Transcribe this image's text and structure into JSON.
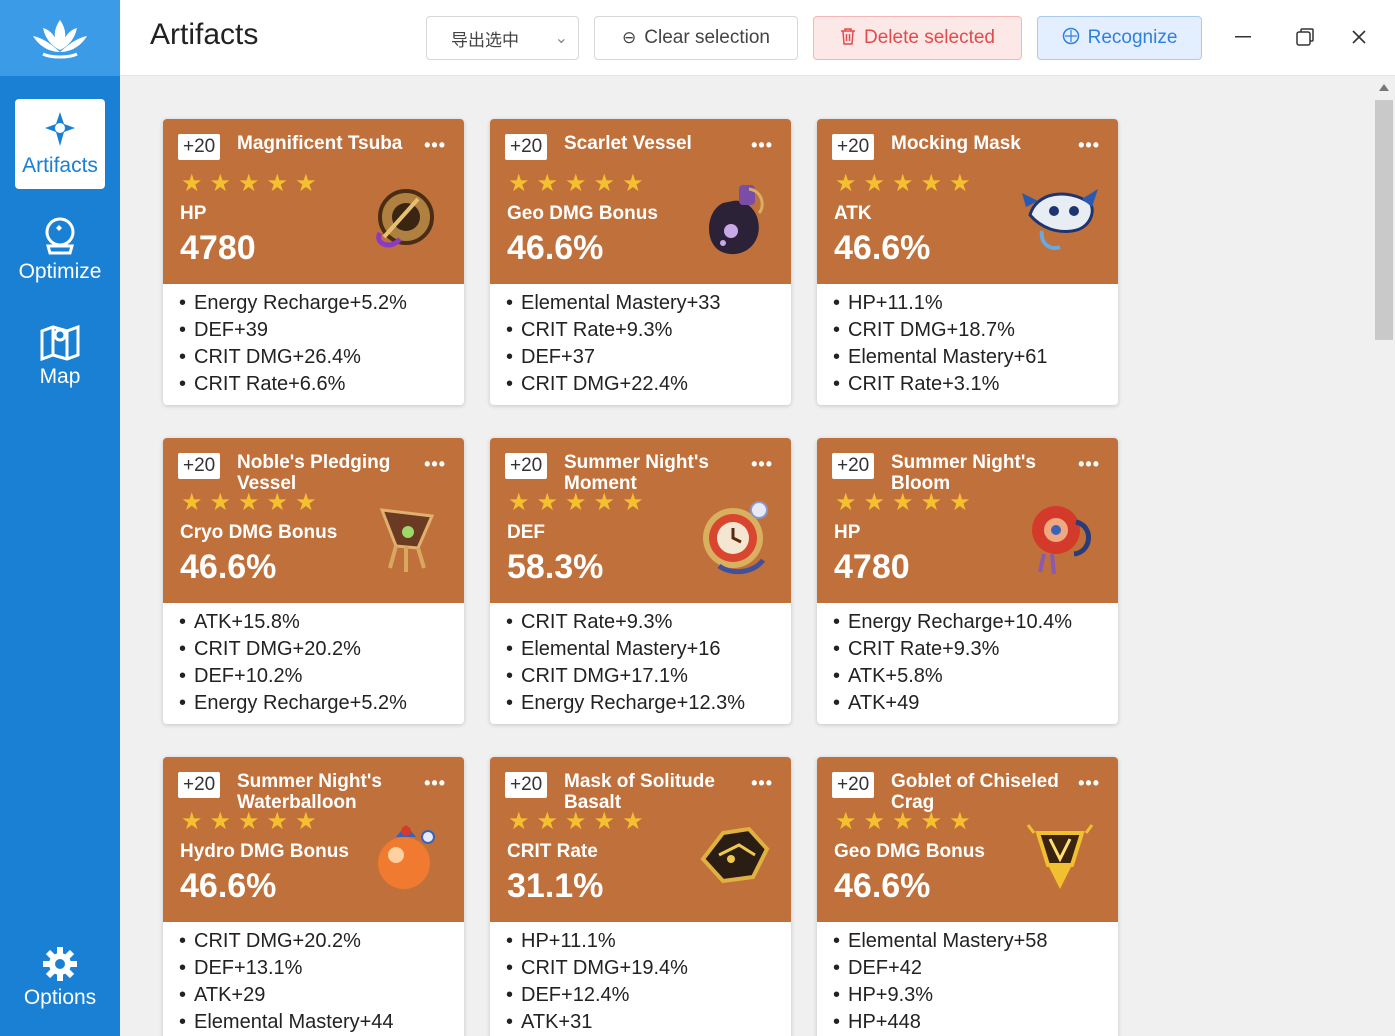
{
  "app": {
    "title": "Artifacts"
  },
  "sidebar": {
    "items": [
      {
        "label": "Artifacts",
        "icon": "artifact-icon"
      },
      {
        "label": "Optimize",
        "icon": "crystal-ball-icon"
      },
      {
        "label": "Map",
        "icon": "map-icon"
      },
      {
        "label": "Options",
        "icon": "gear-icon"
      }
    ]
  },
  "toolbar": {
    "export_label": "导出选中",
    "clear_label": "Clear selection",
    "delete_label": "Delete selected",
    "recognize_label": "Recognize"
  },
  "colors": {
    "sidebar": "#1a80d4",
    "card_header": "#c0703a",
    "star": "#f5c030",
    "delete": "#e14b4b",
    "recognize": "#2f7fe0"
  },
  "cards": [
    {
      "level": "+20",
      "name": "Magnificent Tsuba",
      "stars": "★★★★★",
      "main_stat": "HP",
      "main_value": "4780",
      "subs": [
        "Energy Recharge+5.2%",
        "DEF+39",
        "CRIT DMG+26.4%",
        "CRIT Rate+6.6%"
      ],
      "art": "tsuba"
    },
    {
      "level": "+20",
      "name": "Scarlet Vessel",
      "stars": "★★★★★",
      "main_stat": "Geo DMG Bonus",
      "main_value": "46.6%",
      "subs": [
        "Elemental Mastery+33",
        "CRIT Rate+9.3%",
        "DEF+37",
        "CRIT DMG+22.4%"
      ],
      "art": "vessel"
    },
    {
      "level": "+20",
      "name": "Mocking Mask",
      "stars": "★★★★★",
      "main_stat": "ATK",
      "main_value": "46.6%",
      "subs": [
        "HP+11.1%",
        "CRIT DMG+18.7%",
        "Elemental Mastery+61",
        "CRIT Rate+3.1%"
      ],
      "art": "mask"
    },
    {
      "level": "+20",
      "name": "Noble's Pledging Vessel",
      "stars": "★★★★★",
      "main_stat": "Cryo DMG Bonus",
      "main_value": "46.6%",
      "subs": [
        "ATK+15.8%",
        "CRIT DMG+20.2%",
        "DEF+10.2%",
        "Energy Recharge+5.2%"
      ],
      "art": "noble"
    },
    {
      "level": "+20",
      "name": "Summer Night's Moment",
      "stars": "★★★★★",
      "main_stat": "DEF",
      "main_value": "58.3%",
      "subs": [
        "CRIT Rate+9.3%",
        "Elemental Mastery+16",
        "CRIT DMG+17.1%",
        "Energy Recharge+12.3%"
      ],
      "art": "clock"
    },
    {
      "level": "+20",
      "name": "Summer Night's Bloom",
      "stars": "★★★★★",
      "main_stat": "HP",
      "main_value": "4780",
      "subs": [
        "Energy Recharge+10.4%",
        "CRIT Rate+9.3%",
        "ATK+5.8%",
        "ATK+49"
      ],
      "art": "bloom"
    },
    {
      "level": "+20",
      "name": "Summer Night's Waterballoon",
      "stars": "★★★★★",
      "main_stat": "Hydro DMG Bonus",
      "main_value": "46.6%",
      "subs": [
        "CRIT DMG+20.2%",
        "DEF+13.1%",
        "ATK+29",
        "Elemental Mastery+44"
      ],
      "art": "balloon"
    },
    {
      "level": "+20",
      "name": "Mask of Solitude Basalt",
      "stars": "★★★★★",
      "main_stat": "CRIT Rate",
      "main_value": "31.1%",
      "subs": [
        "HP+11.1%",
        "CRIT DMG+19.4%",
        "DEF+12.4%",
        "ATK+31"
      ],
      "art": "basalt"
    },
    {
      "level": "+20",
      "name": "Goblet of Chiseled Crag",
      "stars": "★★★★★",
      "main_stat": "Geo DMG Bonus",
      "main_value": "46.6%",
      "subs": [
        "Elemental Mastery+58",
        "DEF+42",
        "HP+9.3%",
        "HP+448"
      ],
      "art": "goblet"
    }
  ]
}
